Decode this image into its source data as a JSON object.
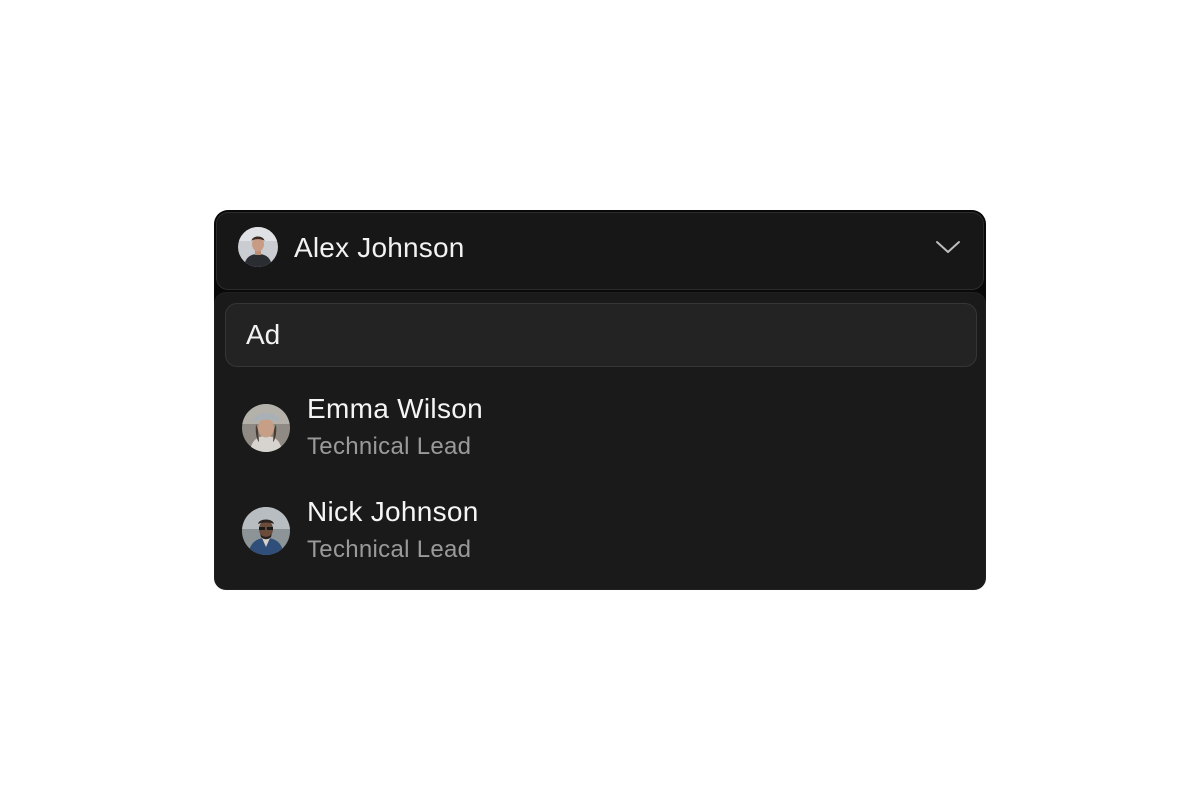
{
  "selector": {
    "selected_name": "Alex Johnson",
    "selected_avatar": "avatar-alex-johnson",
    "chevron_icon": "chevron-down-icon"
  },
  "search": {
    "value": "Ad"
  },
  "options": [
    {
      "name": "Emma Wilson",
      "role": "Technical Lead",
      "avatar": "avatar-emma-wilson"
    },
    {
      "name": "Nick Johnson",
      "role": "Technical Lead",
      "avatar": "avatar-nick-johnson"
    }
  ],
  "colors": {
    "page_background": "#ffffff",
    "trigger_background": "#171717",
    "panel_background": "#1a1a1a",
    "search_background": "#232323",
    "primary_text": "#f2f2f2",
    "secondary_text": "#9a9a9a"
  }
}
